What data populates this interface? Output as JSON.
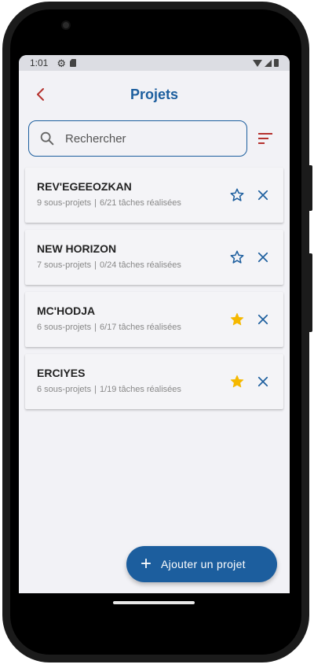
{
  "status_bar": {
    "time": "1:01",
    "icons": [
      "gear-icon",
      "sd-card-icon",
      "wifi-icon",
      "signal-icon",
      "battery-icon"
    ]
  },
  "header": {
    "title": "Projets",
    "back_icon": "chevron-left-icon"
  },
  "search": {
    "placeholder": "Rechercher",
    "value": ""
  },
  "projects": [
    {
      "name": "REV'EGEEOZKAN",
      "subprojects": "9 sous-projets",
      "tasks": "6/21 tâches réalisées",
      "favorite": false
    },
    {
      "name": "NEW HORIZON",
      "subprojects": "7 sous-projets",
      "tasks": "0/24 tâches réalisées",
      "favorite": false
    },
    {
      "name": "MC'HODJA",
      "subprojects": "6 sous-projets",
      "tasks": "6/17 tâches réalisées",
      "favorite": true
    },
    {
      "name": "ERCIYES",
      "subprojects": "6 sous-projets",
      "tasks": "1/19 tâches réalisées",
      "favorite": true
    }
  ],
  "separator": "|",
  "fab": {
    "icon": "plus-icon",
    "label": "Ajouter un projet"
  },
  "colors": {
    "primary": "#1c5e9e",
    "accent_red": "#b5322e",
    "star_filled": "#f5b800",
    "background": "#f2f2f6"
  }
}
